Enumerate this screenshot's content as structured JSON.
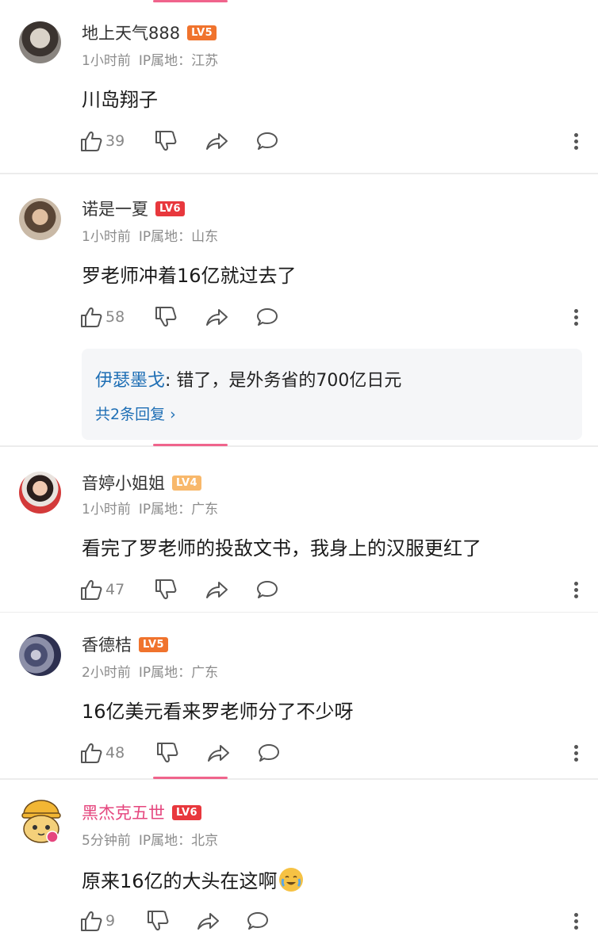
{
  "colors": {
    "lv5": "#f0732d",
    "lv6": "#e8383d",
    "lv4": "#f8b86b",
    "vip_name": "#e5467e",
    "link": "#1f6fb5"
  },
  "comments": [
    {
      "username": "地上天气888",
      "level": "LV5",
      "time": "1小时前",
      "ip": "IP属地：江苏",
      "text": "川岛翔子",
      "likes": "39"
    },
    {
      "username": "诺是一夏",
      "level": "LV6",
      "time": "1小时前",
      "ip": "IP属地：山东",
      "text": "罗老师冲着16亿就过去了",
      "likes": "58",
      "reply": {
        "user": "伊瑟墨戈",
        "text": ": 错了，是外务省的700亿日元",
        "more": "共2条回复 ›"
      }
    },
    {
      "username": "音婷小姐姐",
      "level": "LV4",
      "time": "1小时前",
      "ip": "IP属地：广东",
      "text": "看完了罗老师的投敌文书，我身上的汉服更红了",
      "likes": "47"
    },
    {
      "username": "香德桔",
      "level": "LV5",
      "time": "2小时前",
      "ip": "IP属地：广东",
      "text": "16亿美元看来罗老师分了不少呀",
      "likes": "48"
    },
    {
      "username": "黑杰克五世",
      "level": "LV6",
      "time": "5分钟前",
      "ip": "IP属地：北京",
      "text": "原来16亿的大头在这啊",
      "likes": "9",
      "emoji": "crying-laughing-emoji"
    }
  ]
}
